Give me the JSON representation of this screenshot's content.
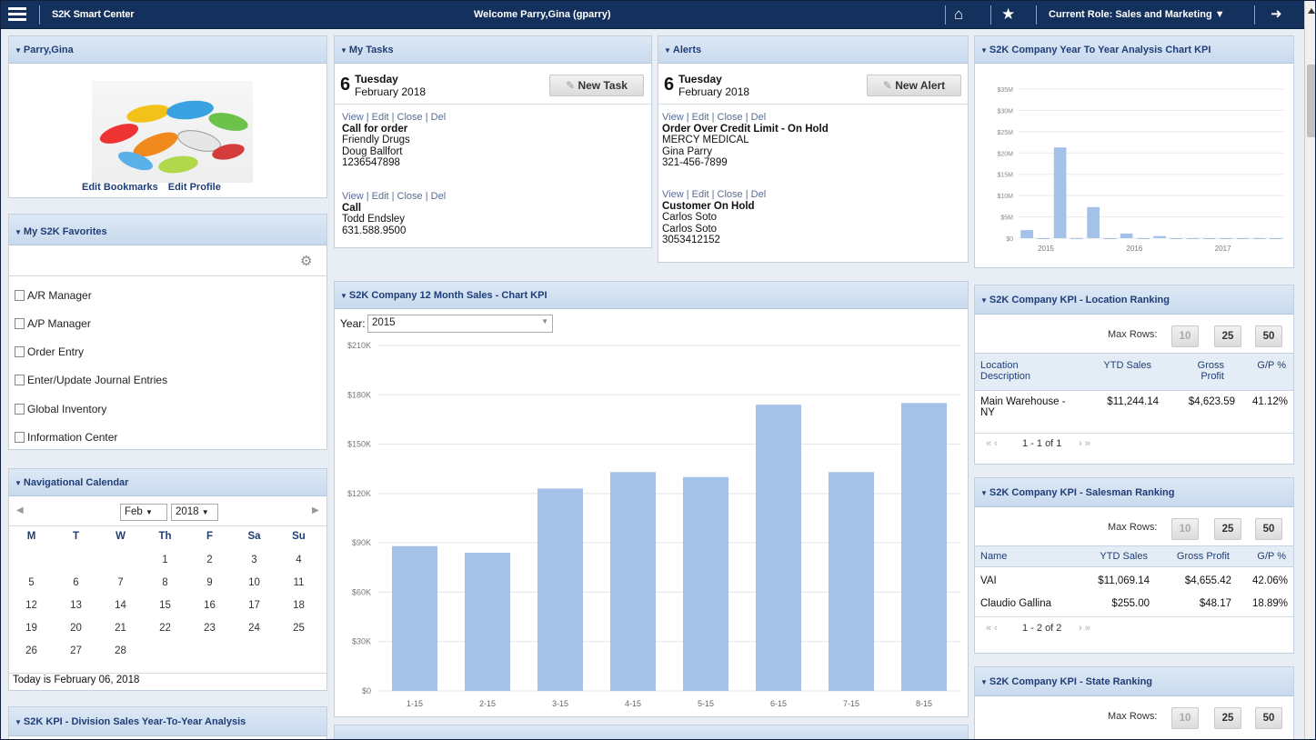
{
  "topbar": {
    "app_name": "S2K Smart Center",
    "welcome": "Welcome Parry,Gina (gparry)",
    "role": "Current Role: Sales and Marketing"
  },
  "profile": {
    "title": "Parry,Gina",
    "edit_bookmarks": "Edit Bookmarks",
    "edit_profile": "Edit Profile"
  },
  "favorites": {
    "title": "My S2K Favorites",
    "items": [
      "A/R Manager",
      "A/P Manager",
      "Order Entry",
      "Enter/Update Journal Entries",
      "Global Inventory",
      "Information Center"
    ]
  },
  "calendar": {
    "title": "Navigational Calendar",
    "month": "Feb",
    "year": "2018",
    "days": [
      "M",
      "T",
      "W",
      "Th",
      "F",
      "Sa",
      "Su"
    ],
    "weeks": [
      [
        "",
        "",
        "",
        "1",
        "2",
        "3",
        "4"
      ],
      [
        "5",
        "6",
        "7",
        "8",
        "9",
        "10",
        "11"
      ],
      [
        "12",
        "13",
        "14",
        "15",
        "16",
        "17",
        "18"
      ],
      [
        "19",
        "20",
        "21",
        "22",
        "23",
        "24",
        "25"
      ],
      [
        "26",
        "27",
        "28",
        "",
        "",
        "",
        ""
      ]
    ],
    "today": "Today is February 06, 2018"
  },
  "division_kpi": {
    "title": "S2K KPI - Division Sales Year-To-Year Analysis"
  },
  "tasks": {
    "title": "My Tasks",
    "day": "6",
    "weekday": "Tuesday",
    "month_year": "February 2018",
    "new_label": "New Task",
    "entries": [
      {
        "actions": "View | Edit | Close | Del",
        "title": "Call for order",
        "lines": [
          "Friendly Drugs",
          "Doug Ballfort",
          "1236547898"
        ]
      },
      {
        "actions": "View | Edit | Close | Del",
        "title": "Call",
        "lines": [
          "Todd Endsley",
          "631.588.9500"
        ]
      }
    ]
  },
  "alerts": {
    "title": "Alerts",
    "day": "6",
    "weekday": "Tuesday",
    "month_year": "February 2018",
    "new_label": "New Alert",
    "entries": [
      {
        "actions": "View | Edit | Close | Del",
        "title": "Order Over Credit Limit - On Hold",
        "lines": [
          "MERCY MEDICAL",
          "Gina Parry",
          "321-456-7899"
        ]
      },
      {
        "actions": "View | Edit | Close | Del",
        "title": "Customer On Hold",
        "lines": [
          "Carlos Soto",
          "Carlos Soto",
          "3053412152"
        ]
      }
    ]
  },
  "sales_chart_panel": {
    "title": "S2K Company 12 Month Sales - Chart KPI",
    "year_label": "Year:",
    "year_value": "2015"
  },
  "yty_panel": {
    "title": "S2K Company Year To Year Analysis Chart KPI"
  },
  "location_rank": {
    "title": "S2K Company KPI - Location Ranking",
    "max_rows_label": "Max Rows:",
    "options": [
      "10",
      "25",
      "50"
    ],
    "headers": [
      "Location Description",
      "YTD Sales",
      "Gross Profit",
      "G/P %"
    ],
    "rows": [
      [
        "Main Warehouse - NY",
        "$11,244.14",
        "$4,623.59",
        "41.12%"
      ]
    ],
    "pager": "1 - 1 of 1"
  },
  "salesman_rank": {
    "title": "S2K Company KPI - Salesman Ranking",
    "max_rows_label": "Max Rows:",
    "options": [
      "10",
      "25",
      "50"
    ],
    "headers": [
      "Name",
      "YTD Sales",
      "Gross Profit",
      "G/P %"
    ],
    "rows": [
      [
        "VAI",
        "$11,069.14",
        "$4,655.42",
        "42.06%"
      ],
      [
        "Claudio Gallina",
        "$255.00",
        "$48.17",
        "18.89%"
      ]
    ],
    "pager": "1 - 2 of 2"
  },
  "state_rank": {
    "title": "S2K Company KPI - State Ranking",
    "max_rows_label": "Max Rows:",
    "options": [
      "10",
      "25",
      "50"
    ]
  },
  "chart_data": [
    {
      "type": "bar",
      "categories": [
        "1-15",
        "2-15",
        "3-15",
        "4-15",
        "5-15",
        "6-15",
        "7-15",
        "8-15"
      ],
      "values": [
        88000,
        84000,
        123000,
        133000,
        130000,
        174000,
        133000,
        175000
      ],
      "ylim": [
        0,
        210000
      ],
      "yticks": [
        "$0",
        "$30K",
        "$60K",
        "$90K",
        "$120K",
        "$150K",
        "$180K",
        "$210K"
      ],
      "grid": true,
      "color": "#a4c2e8"
    },
    {
      "type": "bar",
      "categories": [
        "2015",
        "2016",
        "2017"
      ],
      "values": [
        1.9,
        0,
        21.3,
        0,
        7.3,
        0,
        1.1,
        0,
        0.5,
        0,
        0,
        0,
        0,
        0,
        0,
        0
      ],
      "ylim": [
        0,
        35
      ],
      "yticks": [
        "$0",
        "$5M",
        "$10M",
        "$15M",
        "$20M",
        "$25M",
        "$30M",
        "$35M"
      ],
      "color": "#a4c2e8"
    }
  ]
}
